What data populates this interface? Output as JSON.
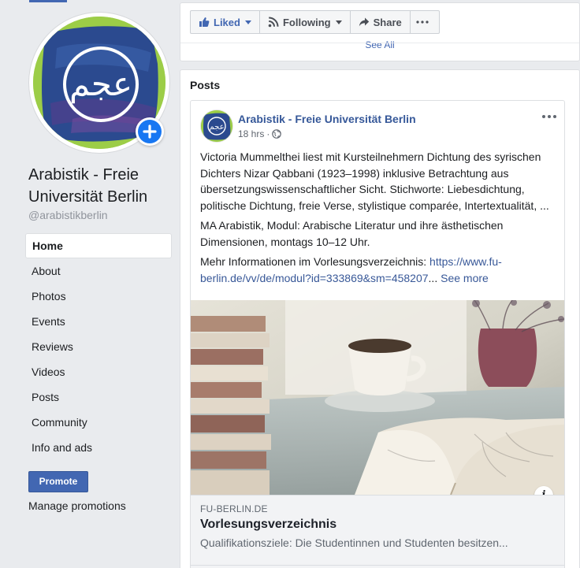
{
  "page": {
    "name": "Arabistik - Freie Universität Berlin",
    "handle": "@arabistikberlin",
    "logo_text": "عجم"
  },
  "sidebar": {
    "nav": [
      {
        "label": "Home",
        "active": true
      },
      {
        "label": "About"
      },
      {
        "label": "Photos"
      },
      {
        "label": "Events"
      },
      {
        "label": "Reviews"
      },
      {
        "label": "Videos"
      },
      {
        "label": "Posts"
      },
      {
        "label": "Community"
      },
      {
        "label": "Info and ads"
      }
    ],
    "promote_label": "Promote",
    "manage_promotions_label": "Manage promotions"
  },
  "actions": {
    "liked": "Liked",
    "following": "Following",
    "share": "Share",
    "see_all": "See All"
  },
  "posts": {
    "heading": "Posts",
    "post": {
      "author": "Arabistik - Freie Universität Berlin",
      "time": "18 hrs",
      "audience_icon": "globe-icon",
      "paragraphs": [
        "Victoria Mummelthei liest mit Kursteilnehmern Dichtung des syrischen Dichters Nizar Qabbani (1923–1998) inklusive Betrachtung aus übersetzungswissenschaftlicher Sicht. Stichworte: Liebesdichtung, politische Dichtung, freie Verse, stylistique comparée, Intertextualität, ...",
        "MA Arabistik, Modul: Arabische Literatur und ihre ästhetischen Dimensionen, montags 10–12 Uhr."
      ],
      "more_info_prefix": "Mehr Informationen im Vorlesungsverzeichnis: ",
      "link_url": "https://www.fu-berlin.de/vv/de/modul?id=333869&sm=458207",
      "ellipsis": "...",
      "see_more": "See more",
      "link_preview": {
        "domain": "FU-BERLIN.DE",
        "title": "Vorlesungsverzeichnis",
        "description": "Qualifikationsziele: Die Studentinnen und Studenten besitzen..."
      },
      "info_icon_text": "i"
    }
  },
  "colors": {
    "facebook_blue": "#4267b2",
    "link_blue": "#385898",
    "logo_green": "#9ccd47",
    "logo_navy": "#2b4a8f"
  }
}
